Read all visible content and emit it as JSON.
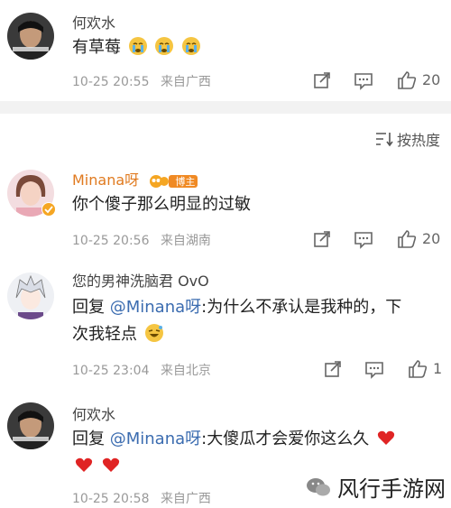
{
  "comments": [
    {
      "name": "何欢水",
      "text": "有草莓",
      "time": "10-25 20:55",
      "location": "来自广西",
      "likes": "20",
      "emojis": [
        "crying-face",
        "crying-face",
        "crying-face"
      ]
    },
    {
      "name": "Minana呀",
      "badge": "博主",
      "text": "你个傻子那么明显的过敏",
      "time": "10-25 20:56",
      "location": "来自湖南",
      "likes": "20"
    },
    {
      "name": "您的男神洗脑君 OvO",
      "reply_prefix": "回复 ",
      "mention": "@Minana呀",
      "text_line1": ":为什么不承认是我种的，下",
      "text_line2": "次我轻点",
      "time": "10-25 23:04",
      "location": "来自北京",
      "likes": "1"
    },
    {
      "name": "何欢水",
      "reply_prefix": "回复 ",
      "mention": "@Minana呀",
      "text_line1": ":大傻瓜才会爱你这么久",
      "time": "10-25 20:58",
      "location": "来自广西"
    }
  ],
  "sort": {
    "label": "按热度"
  },
  "watermark": {
    "text": "风行手游网"
  },
  "colors": {
    "mention": "#3b6cb0",
    "meta": "#999999",
    "name_vip": "#e07a1f",
    "heart": "#e02424"
  }
}
